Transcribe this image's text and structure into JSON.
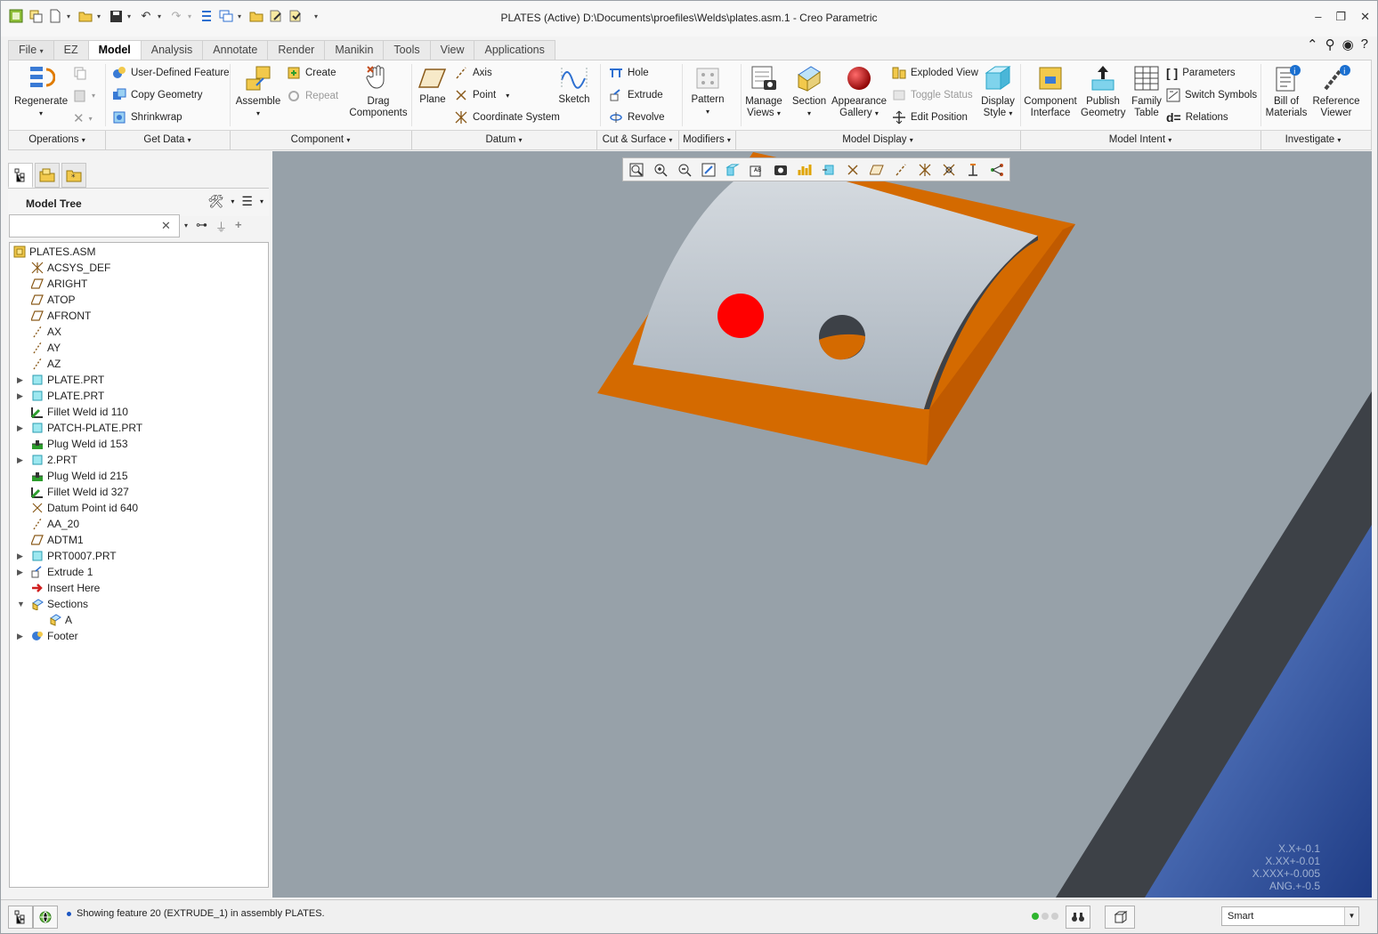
{
  "window": {
    "title": "PLATES (Active) D:\\Documents\\proefiles\\Welds\\plates.asm.1 - Creo Parametric",
    "controls": [
      "minimize-icon",
      "restore-icon",
      "close-icon"
    ]
  },
  "tabs": [
    {
      "label": "File",
      "arrow": "▾"
    },
    {
      "label": "EZ"
    },
    {
      "label": "Model"
    },
    {
      "label": "Analysis"
    },
    {
      "label": "Annotate"
    },
    {
      "label": "Render"
    },
    {
      "label": "Manikin"
    },
    {
      "label": "Tools"
    },
    {
      "label": "View"
    },
    {
      "label": "Applications"
    }
  ],
  "active_tab": "Model",
  "ribbon": {
    "operations": {
      "regenerate": "Regenerate",
      "group": "Operations"
    },
    "get_data": {
      "udf": "User-Defined Feature",
      "copy_geometry": "Copy Geometry",
      "shrinkwrap": "Shrinkwrap",
      "group": "Get Data"
    },
    "component": {
      "assemble": "Assemble",
      "create": "Create",
      "repeat": "Repeat",
      "drag1": "Drag",
      "drag2": "Components",
      "group": "Component"
    },
    "datum": {
      "plane": "Plane",
      "axis": "Axis",
      "point": "Point",
      "csys": "Coordinate System",
      "sketch": "Sketch",
      "group": "Datum"
    },
    "cut_surface": {
      "hole": "Hole",
      "extrude": "Extrude",
      "revolve": "Revolve",
      "group": "Cut & Surface"
    },
    "modifiers": {
      "pattern": "Pattern",
      "group": "Modifiers"
    },
    "model_display": {
      "manage1": "Manage",
      "manage2": "Views",
      "section": "Section",
      "appearance1": "Appearance",
      "appearance2": "Gallery",
      "exploded": "Exploded View",
      "toggle": "Toggle Status",
      "edit_pos": "Edit Position",
      "display1": "Display",
      "display2": "Style",
      "group": "Model Display"
    },
    "model_intent": {
      "ci1": "Component",
      "ci2": "Interface",
      "pg1": "Publish",
      "pg2": "Geometry",
      "ft1": "Family",
      "ft2": "Table",
      "parameters": "Parameters",
      "switch_symbols": "Switch Symbols",
      "relations": "Relations",
      "group": "Model Intent"
    },
    "investigate": {
      "bom1": "Bill of",
      "bom2": "Materials",
      "rv1": "Reference",
      "rv2": "Viewer",
      "group": "Investigate"
    }
  },
  "left_panel": {
    "title": "Model Tree",
    "search": {
      "value": "",
      "placeholder": ""
    },
    "tree": [
      {
        "label": "PLATES.ASM",
        "icon": "assembly-icon",
        "level": 0,
        "expander": ""
      },
      {
        "label": "ACSYS_DEF",
        "icon": "csys-icon",
        "level": 1,
        "expander": ""
      },
      {
        "label": "ARIGHT",
        "icon": "datum-plane-icon",
        "level": 1,
        "expander": ""
      },
      {
        "label": "ATOP",
        "icon": "datum-plane-icon",
        "level": 1,
        "expander": ""
      },
      {
        "label": "AFRONT",
        "icon": "datum-plane-icon",
        "level": 1,
        "expander": ""
      },
      {
        "label": "AX",
        "icon": "datum-axis-icon",
        "level": 1,
        "expander": ""
      },
      {
        "label": "AY",
        "icon": "datum-axis-icon",
        "level": 1,
        "expander": ""
      },
      {
        "label": "AZ",
        "icon": "datum-axis-icon",
        "level": 1,
        "expander": ""
      },
      {
        "label": "PLATE.PRT",
        "icon": "part-icon",
        "level": 1,
        "expander": "▶"
      },
      {
        "label": "PLATE.PRT",
        "icon": "part-icon",
        "level": 1,
        "expander": "▶"
      },
      {
        "label": "Fillet Weld id 110",
        "icon": "fillet-weld-icon",
        "level": 1,
        "expander": ""
      },
      {
        "label": "PATCH-PLATE.PRT",
        "icon": "part-icon",
        "level": 1,
        "expander": "▶"
      },
      {
        "label": "Plug Weld id 153",
        "icon": "plug-weld-icon",
        "level": 1,
        "expander": ""
      },
      {
        "label": "2.PRT",
        "icon": "part-icon",
        "level": 1,
        "expander": "▶"
      },
      {
        "label": "Plug Weld id 215",
        "icon": "plug-weld-icon",
        "level": 1,
        "expander": ""
      },
      {
        "label": "Fillet Weld id 327",
        "icon": "fillet-weld-icon",
        "level": 1,
        "expander": ""
      },
      {
        "label": "Datum Point id 640",
        "icon": "datum-point-icon",
        "level": 1,
        "expander": ""
      },
      {
        "label": "AA_20",
        "icon": "datum-axis-icon",
        "level": 1,
        "expander": ""
      },
      {
        "label": "ADTM1",
        "icon": "datum-plane-icon",
        "level": 1,
        "expander": ""
      },
      {
        "label": "PRT0007.PRT",
        "icon": "part-icon",
        "level": 1,
        "expander": "▶"
      },
      {
        "label": "Extrude 1",
        "icon": "extrude-icon",
        "level": 1,
        "expander": "▶"
      },
      {
        "label": "Insert Here",
        "icon": "insert-here-icon",
        "level": 1,
        "expander": ""
      },
      {
        "label": "Sections",
        "icon": "sections-icon",
        "level": 1,
        "expander": "▼"
      },
      {
        "label": "A",
        "icon": "section-icon",
        "level": 2,
        "expander": ""
      },
      {
        "label": "Footer",
        "icon": "footer-icon",
        "level": 1,
        "expander": "▶"
      }
    ]
  },
  "viewport": {
    "tolerances": [
      "X.X+-0.1",
      "X.XX+-0.01",
      "X.XXX+-0.005",
      "ANG.+-0.5"
    ],
    "colors": {
      "background": "#97a1a9",
      "plate": "#d46a00",
      "surface": "#b8c2cc",
      "hole_mark": "#ff0000",
      "edge": "#3d4147",
      "blue_plate": "#2f4f96"
    }
  },
  "status": {
    "message": "Showing feature 20 (EXTRUDE_1) in assembly PLATES.",
    "filter": "Smart"
  }
}
